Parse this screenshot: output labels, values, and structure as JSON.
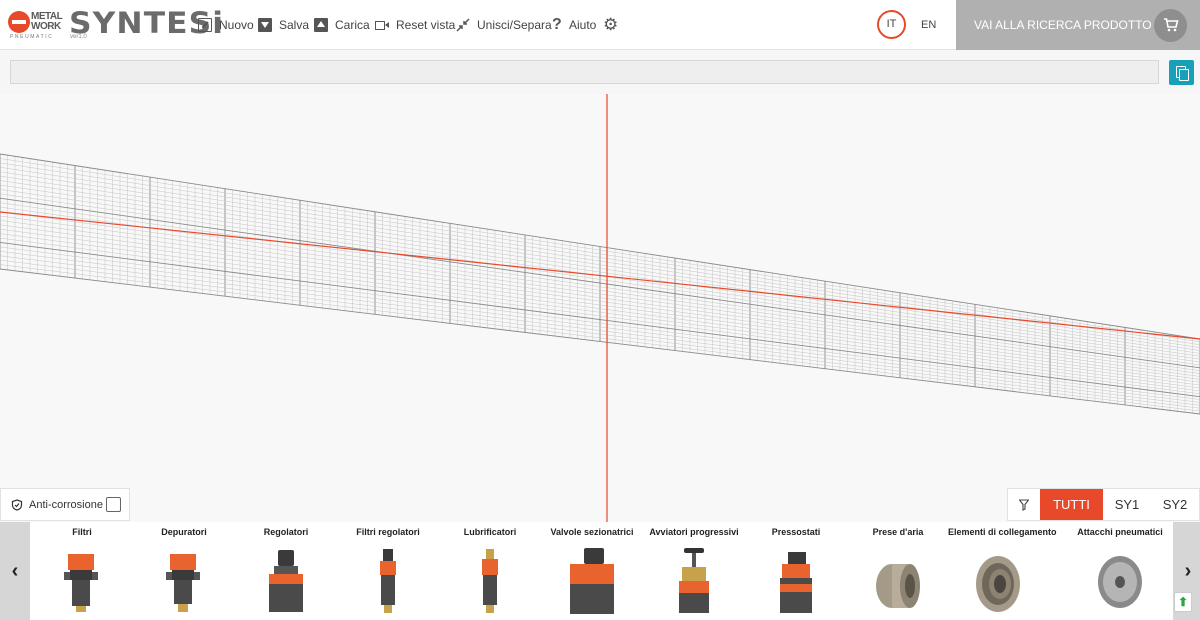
{
  "header": {
    "brand_line1": "METAL",
    "brand_line2": "WORK",
    "brand_sub": "PNEUMATIC",
    "app_name": "SYNTESi",
    "app_version": "ver1.0",
    "tools": [
      {
        "label": "Nuovo",
        "icon": "new-file-icon"
      },
      {
        "label": "Salva",
        "icon": "save-download-icon"
      },
      {
        "label": "Carica",
        "icon": "upload-icon"
      },
      {
        "label": "Reset vista",
        "icon": "video-camera-icon"
      },
      {
        "label": "Unisci/Separa",
        "icon": "collapse-arrows-icon"
      },
      {
        "label": "Aiuto",
        "icon": "question-icon"
      }
    ],
    "lang_it": "IT",
    "lang_en": "EN",
    "search_button": "VAI ALLA RICERCA PRODOTTO"
  },
  "code_bar": {
    "value": ""
  },
  "anti_corrosion": {
    "label": "Anti-corrosione",
    "checked": false
  },
  "filters": {
    "tabs": [
      "TUTTI",
      "SY1",
      "SY2"
    ],
    "active": "TUTTI"
  },
  "categories": [
    "Filtri",
    "Depuratori",
    "Regolatori",
    "Filtri regolatori",
    "Lubrificatori",
    "Valvole sezionatrici",
    "Avviatori progressivi",
    "Pressostati",
    "Prese d'aria",
    "Elementi di collegamento",
    "Attacchi pneumatici"
  ],
  "colors": {
    "accent": "#e8492a",
    "teal": "#18a0b8",
    "grey_button": "#b0b0b0"
  }
}
